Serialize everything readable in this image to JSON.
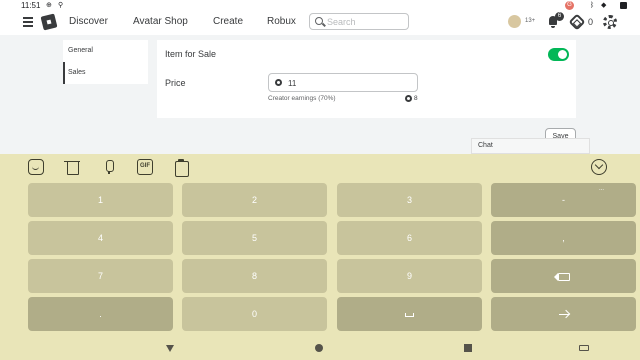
{
  "status_bar": {
    "time": "11:51",
    "icons": [
      "sync-icon",
      "search-icon",
      "wifi-icon",
      "battery-icon"
    ],
    "notification_count": "G"
  },
  "nav": {
    "links": [
      "Discover",
      "Avatar Shop",
      "Create",
      "Robux"
    ],
    "search_placeholder": "Search",
    "age_label": "13+",
    "notification_count": "6",
    "robux_balance": "0"
  },
  "sidebar": {
    "items": [
      "General",
      "Sales"
    ],
    "active": "Sales"
  },
  "sale": {
    "item_for_sale_label": "Item for Sale",
    "item_for_sale_on": true,
    "price_label": "Price",
    "price_value": "11",
    "earnings_label": "Creator earnings (70%)",
    "earnings_value": "8"
  },
  "save_label": "Save",
  "chat_label": "Chat",
  "keyboard": {
    "toolbar": [
      "emoji-icon",
      "shirt-icon",
      "mic-icon",
      "gif-icon",
      "clipboard-icon"
    ],
    "gif_label": "GIF",
    "rows": [
      [
        "1",
        "2",
        "3",
        "-"
      ],
      [
        "4",
        "5",
        "6",
        ","
      ],
      [
        "7",
        "8",
        "9",
        "backspace"
      ],
      [
        ".",
        "0",
        "space",
        "enter"
      ]
    ],
    "hint_label": "..."
  },
  "colors": {
    "toggle_on": "#02b757",
    "keyboard_bg": "#e9e5b8",
    "key_bg": "#c8c49c"
  }
}
